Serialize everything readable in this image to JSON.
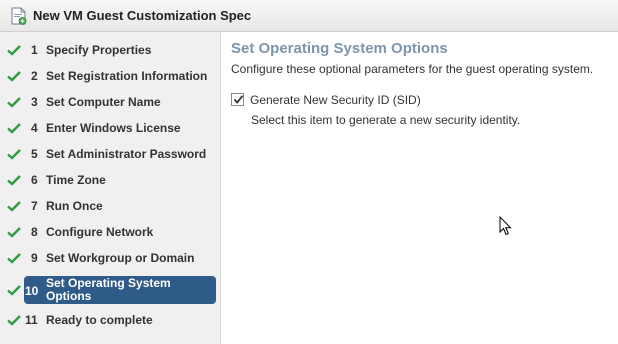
{
  "window": {
    "title": "New VM Guest Customization Spec"
  },
  "sidebar": {
    "steps": [
      {
        "number": "1",
        "label": "Specify Properties",
        "completed": true
      },
      {
        "number": "2",
        "label": "Set Registration Information",
        "completed": true
      },
      {
        "number": "3",
        "label": "Set Computer Name",
        "completed": true
      },
      {
        "number": "4",
        "label": "Enter Windows License",
        "completed": true
      },
      {
        "number": "5",
        "label": "Set Administrator Password",
        "completed": true
      },
      {
        "number": "6",
        "label": "Time Zone",
        "completed": true
      },
      {
        "number": "7",
        "label": "Run Once",
        "completed": true
      },
      {
        "number": "8",
        "label": "Configure Network",
        "completed": true
      },
      {
        "number": "9",
        "label": "Set Workgroup or Domain",
        "completed": true
      },
      {
        "number": "10",
        "label": "Set Operating System Options",
        "completed": true,
        "active": true
      },
      {
        "number": "11",
        "label": "Ready to complete",
        "completed": true
      }
    ]
  },
  "main": {
    "title": "Set Operating System Options",
    "description": "Configure these optional parameters for the guest operating system.",
    "sid_option": {
      "label": "Generate New Security ID (SID)",
      "help": "Select this item to generate a new security identity.",
      "checked": true
    }
  },
  "colors": {
    "check_green": "#2e9b3e",
    "active_step_bg": "#2e5b87",
    "page_title": "#7d95ad"
  },
  "icons": {
    "window_icon": "new-spec-icon",
    "step_status": "green-check-icon",
    "pointer": "mouse-cursor-icon"
  }
}
